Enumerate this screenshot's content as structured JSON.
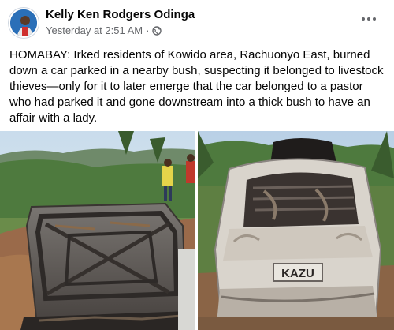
{
  "post": {
    "author": "Kelly Ken Rodgers Odinga",
    "timestamp": "Yesterday at 2:51 AM",
    "separator": "·",
    "privacy_icon": "globe-icon",
    "more_icon": "more-options-icon",
    "text": "HOMABAY: Irked residents of Kowido area, Rachuonyo East, burned down a car parked in a nearby bush, suspecting it belonged to livestock thieves—only for it to later emerge that the car belonged to a pastor who had parked it and gone downstream into a thick bush to have an affair with a lady."
  },
  "photos": [
    {
      "name": "burned-car-hood-photo"
    },
    {
      "name": "burned-car-rear-photo",
      "plate_text": "KAZU"
    }
  ],
  "colors": {
    "text_primary": "#050505",
    "text_secondary": "#65676b"
  }
}
